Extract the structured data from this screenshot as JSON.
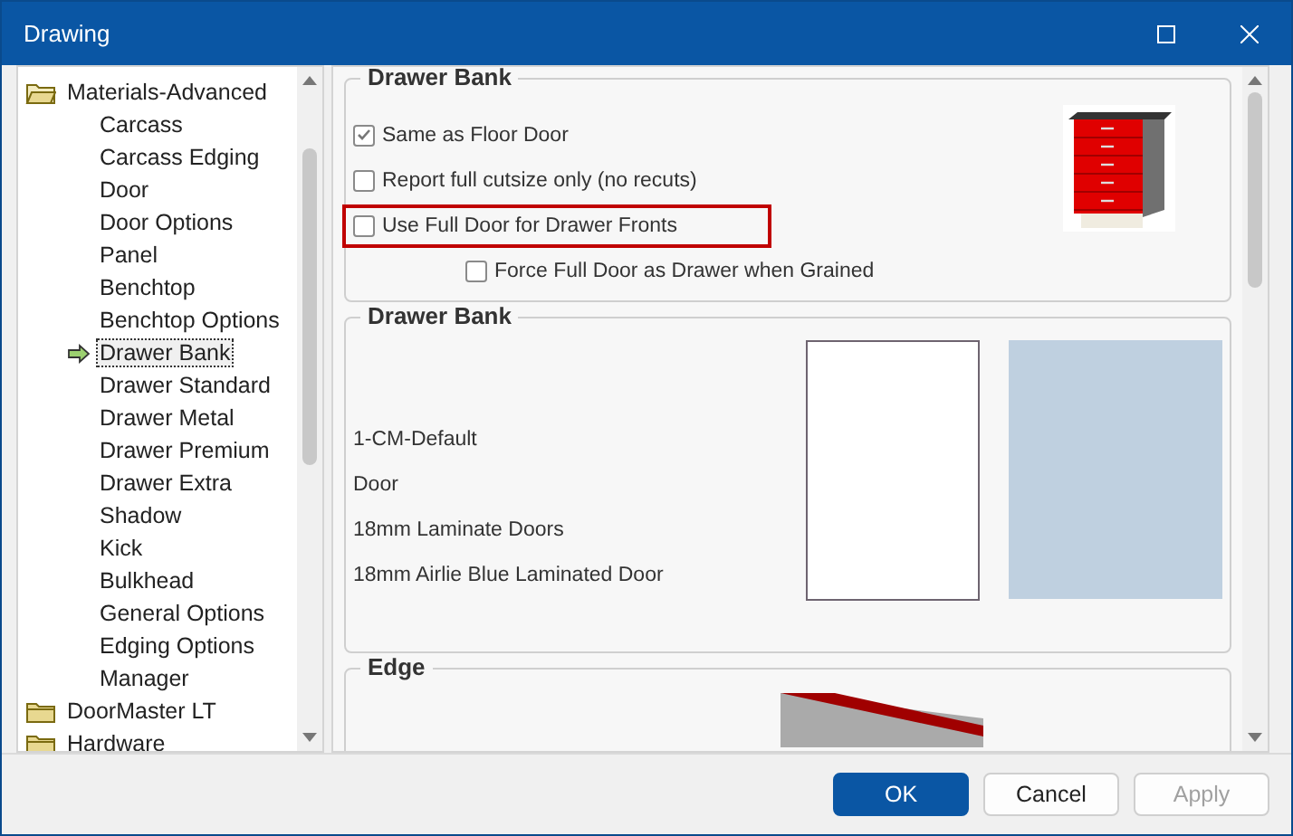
{
  "window": {
    "title": "Drawing"
  },
  "tree": [
    {
      "label": "Materials-Advanced",
      "expanded": true,
      "children": [
        {
          "label": "Carcass",
          "selected": false
        },
        {
          "label": "Carcass Edging",
          "selected": false
        },
        {
          "label": "Door",
          "selected": false
        },
        {
          "label": "Door Options",
          "selected": false
        },
        {
          "label": "Panel",
          "selected": false
        },
        {
          "label": "Benchtop",
          "selected": false
        },
        {
          "label": "Benchtop Options",
          "selected": false
        },
        {
          "label": "Drawer Bank",
          "selected": true
        },
        {
          "label": "Drawer Standard",
          "selected": false
        },
        {
          "label": "Drawer Metal",
          "selected": false
        },
        {
          "label": "Drawer Premium",
          "selected": false
        },
        {
          "label": "Drawer Extra",
          "selected": false
        },
        {
          "label": "Shadow",
          "selected": false
        },
        {
          "label": "Kick",
          "selected": false
        },
        {
          "label": "Bulkhead",
          "selected": false
        },
        {
          "label": "General Options",
          "selected": false
        },
        {
          "label": "Edging Options",
          "selected": false
        },
        {
          "label": "Manager",
          "selected": false
        }
      ]
    },
    {
      "label": "DoorMaster LT",
      "expanded": false
    },
    {
      "label": "Hardware",
      "expanded": false
    }
  ],
  "options_group": {
    "title": "Drawer Bank",
    "options": [
      {
        "label": "Same as Floor Door",
        "checked": true,
        "kind": "option",
        "highlighted": false
      },
      {
        "label": "Report full cutsize only (no recuts)",
        "checked": false,
        "kind": "option",
        "highlighted": false
      },
      {
        "label": "Use Full Door for Drawer Fronts",
        "checked": false,
        "kind": "option",
        "highlighted": true
      },
      {
        "label": "Force Full Door as Drawer when Grained",
        "checked": false,
        "kind": "sub_option",
        "highlighted": false
      }
    ]
  },
  "material_group": {
    "title": "Drawer Bank",
    "lines": [
      "1-CM-Default",
      "Door",
      "18mm Laminate Doors",
      "18mm Airlie Blue Laminated Door"
    ]
  },
  "edge_group": {
    "title": "Edge"
  },
  "buttons": [
    {
      "label": "OK",
      "kind": "primary",
      "disabled": false
    },
    {
      "label": "Cancel",
      "kind": "normal",
      "disabled": false
    },
    {
      "label": "Apply",
      "kind": "normal",
      "disabled": true
    }
  ]
}
